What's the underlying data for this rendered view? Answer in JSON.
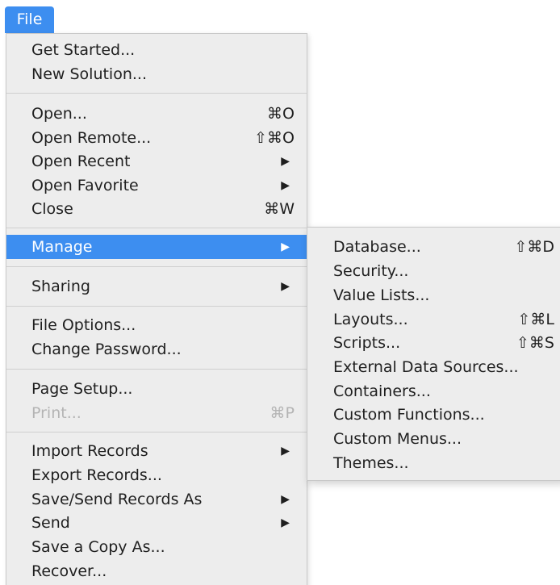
{
  "menubar": {
    "file_label": "File"
  },
  "file_menu": {
    "get_started": "Get Started...",
    "new_solution": "New Solution...",
    "open": {
      "label": "Open...",
      "shortcut": "⌘O"
    },
    "open_remote": {
      "label": "Open Remote...",
      "shortcut": "⇧⌘O"
    },
    "open_recent": {
      "label": "Open Recent",
      "arrow": "▶"
    },
    "open_favorite": {
      "label": "Open Favorite",
      "arrow": "▶"
    },
    "close": {
      "label": "Close",
      "shortcut": "⌘W"
    },
    "manage": {
      "label": "Manage",
      "arrow": "▶"
    },
    "sharing": {
      "label": "Sharing",
      "arrow": "▶"
    },
    "file_options": "File Options...",
    "change_password": "Change Password...",
    "page_setup": "Page Setup...",
    "print": {
      "label": "Print...",
      "shortcut": "⌘P"
    },
    "import_records": {
      "label": "Import Records",
      "arrow": "▶"
    },
    "export_records": "Export Records...",
    "save_send_records_as": {
      "label": "Save/Send Records As",
      "arrow": "▶"
    },
    "send": {
      "label": "Send",
      "arrow": "▶"
    },
    "save_a_copy_as": "Save a Copy As...",
    "recover": "Recover..."
  },
  "manage_submenu": {
    "database": {
      "label": "Database...",
      "shortcut": "⇧⌘D"
    },
    "security": "Security...",
    "value_lists": "Value Lists...",
    "layouts": {
      "label": "Layouts...",
      "shortcut": "⇧⌘L"
    },
    "scripts": {
      "label": "Scripts...",
      "shortcut": "⇧⌘S"
    },
    "external_data_sources": "External Data Sources...",
    "containers": "Containers...",
    "custom_functions": "Custom Functions...",
    "custom_menus": "Custom Menus...",
    "themes": "Themes..."
  },
  "colors": {
    "highlight": "#3d8ef0",
    "menu_background": "#ededed",
    "disabled_text": "#b4b4b4"
  }
}
